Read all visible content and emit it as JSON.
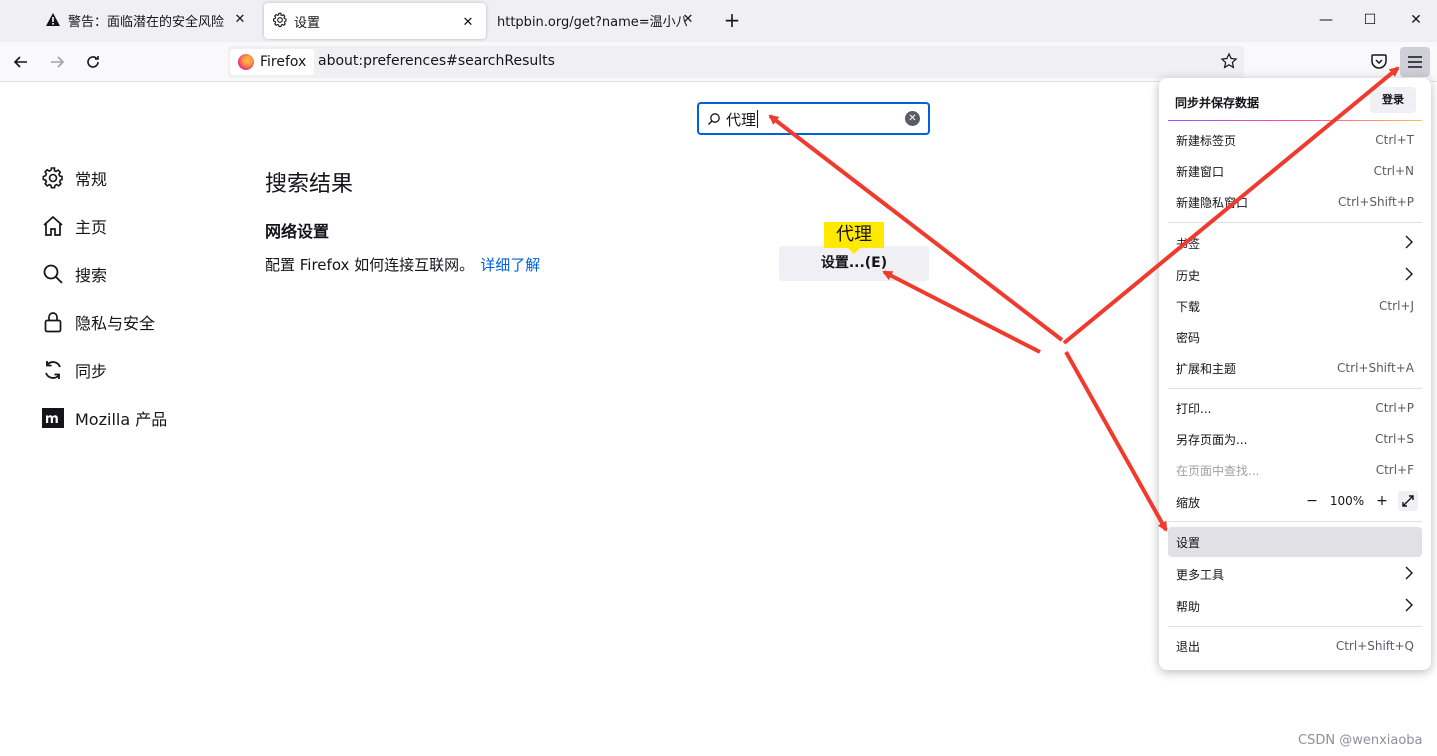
{
  "tabs": [
    {
      "label": "警告：面临潜在的安全风险"
    },
    {
      "label": "设置"
    },
    {
      "label": "httpbin.org/get?name=温小八&a"
    }
  ],
  "navbar": {
    "identity_label": "Firefox",
    "url": "about:preferences#searchResults"
  },
  "prefs": {
    "search_value": "代理",
    "categories": [
      {
        "label": "常规",
        "icon": "gear-icon"
      },
      {
        "label": "主页",
        "icon": "home-icon"
      },
      {
        "label": "搜索",
        "icon": "search-icon"
      },
      {
        "label": "隐私与安全",
        "icon": "lock-icon"
      },
      {
        "label": "同步",
        "icon": "sync-icon"
      },
      {
        "label": "Mozilla 产品",
        "icon": "mozilla-icon"
      }
    ],
    "results_title": "搜索结果",
    "network_heading": "网络设置",
    "network_desc": "配置 Firefox 如何连接互联网。",
    "learn_more": "详细了解",
    "settings_button": "设置...(E)",
    "highlight_badge": "代理"
  },
  "menu": {
    "sync_title": "同步并保存数据",
    "login_label": "登录",
    "items": [
      {
        "label": "新建标签页",
        "accel": "Ctrl+T"
      },
      {
        "label": "新建窗口",
        "accel": "Ctrl+N"
      },
      {
        "label": "新建隐私窗口",
        "accel": "Ctrl+Shift+P"
      },
      {
        "label": "书签",
        "accel": ""
      },
      {
        "label": "历史",
        "accel": ""
      },
      {
        "label": "下载",
        "accel": "Ctrl+J"
      },
      {
        "label": "密码",
        "accel": ""
      },
      {
        "label": "扩展和主题",
        "accel": "Ctrl+Shift+A"
      },
      {
        "label": "打印...",
        "accel": "Ctrl+P"
      },
      {
        "label": "另存页面为...",
        "accel": "Ctrl+S"
      },
      {
        "label": "在页面中查找...",
        "accel": "Ctrl+F"
      },
      {
        "label": "缩放",
        "accel": ""
      },
      {
        "label": "设置",
        "accel": ""
      },
      {
        "label": "更多工具",
        "accel": ""
      },
      {
        "label": "帮助",
        "accel": ""
      },
      {
        "label": "退出",
        "accel": "Ctrl+Shift+Q"
      }
    ],
    "zoom_value": "100%",
    "zoom_minus": "−",
    "zoom_plus": "+"
  },
  "watermark": "CSDN @wenxiaoba",
  "colors": {
    "accent": "#0061e0",
    "arrow": "#f03a2e",
    "highlight_yellow": "#ffe900"
  }
}
